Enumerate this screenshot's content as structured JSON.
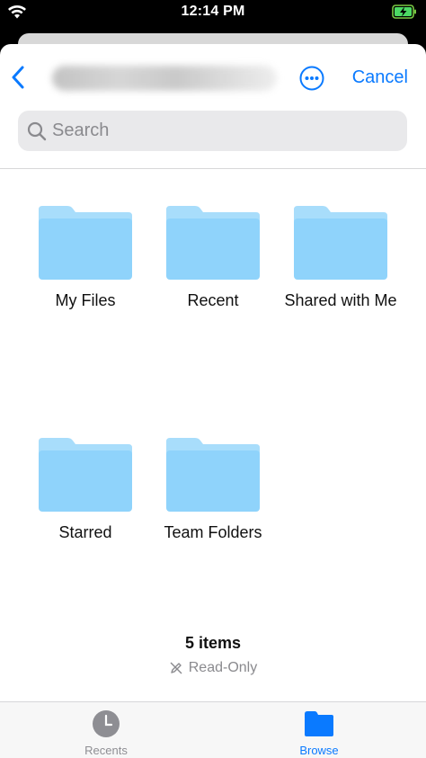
{
  "status_bar": {
    "time": "12:14 PM"
  },
  "nav": {
    "cancel_label": "Cancel"
  },
  "search": {
    "placeholder": "Search"
  },
  "folders": [
    {
      "label": "My Files"
    },
    {
      "label": "Recent"
    },
    {
      "label": "Shared with Me"
    },
    {
      "label": "Starred"
    },
    {
      "label": "Team Folders"
    }
  ],
  "summary": {
    "items_count": "5 items",
    "access": "Read-Only"
  },
  "tabs": [
    {
      "label": "Recents",
      "icon": "clock-icon"
    },
    {
      "label": "Browse",
      "icon": "folder-icon",
      "active": true
    }
  ],
  "colors": {
    "accent": "#0a7aff",
    "folder": "#8fd3fb",
    "folder_tab": "#a8ddfb"
  }
}
